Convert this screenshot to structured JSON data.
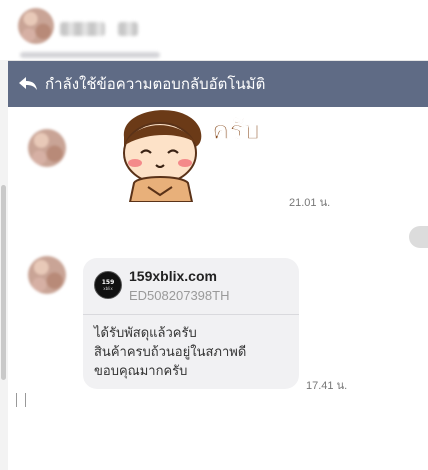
{
  "header": {
    "reply_banner_text": "กำลังใช้ข้อความตอบกลับอัตโนมัติ",
    "reply_icon": "reply-arrow-icon"
  },
  "messages": [
    {
      "type": "sticker",
      "sticker_text": "ครับ",
      "time": "21.01 น."
    },
    {
      "type": "card",
      "card_title": "159xblix.com",
      "card_subtitle": "ED508207398TH",
      "logo_text_1": "159",
      "logo_text_2": "xblix",
      "body_lines": [
        "ได้รับพัสดุแล้วครับ",
        "สินค้าครบถ้วนอยู่ในสภาพดี",
        "ขอบคุณมากครับ"
      ],
      "time": "17.41 น."
    }
  ],
  "colors": {
    "banner_bg": "#5f6b85",
    "card_bg": "#f1f1f3",
    "sticker_text": "#8a4e22"
  }
}
